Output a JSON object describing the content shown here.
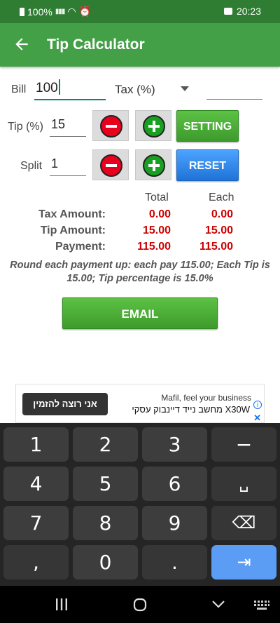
{
  "status": {
    "battery": "100%",
    "time": "20:23"
  },
  "app": {
    "title": "Tip Calculator"
  },
  "bill": {
    "label": "Bill",
    "value": "100"
  },
  "tax": {
    "selected": "Tax (%)",
    "value": ""
  },
  "tip": {
    "label": "Tip (%)",
    "value": "15"
  },
  "split": {
    "label": "Split",
    "value": "1"
  },
  "buttons": {
    "setting": "SETTING",
    "reset": "RESET",
    "email": "EMAIL"
  },
  "results": {
    "headers": {
      "total": "Total",
      "each": "Each"
    },
    "rows": [
      {
        "label": "Tax Amount:",
        "total": "0.00",
        "each": "0.00"
      },
      {
        "label": "Tip Amount:",
        "total": "15.00",
        "each": "15.00"
      },
      {
        "label": "Payment:",
        "total": "115.00",
        "each": "115.00"
      }
    ],
    "summary": "Round each payment up: each pay 115.00; Each Tip is 15.00; Tip percentage is 15.0%"
  },
  "ad": {
    "button": "אני רוצה להזמין",
    "line1": "Mafil, feel your business",
    "line2": "מחשב נייד דיינבוק עסקי X30W"
  },
  "keyboard": {
    "keys": [
      "1",
      "2",
      "3",
      "−",
      "4",
      "5",
      "6",
      "␣",
      "7",
      "8",
      "9",
      "⌫",
      ",",
      "0",
      ".",
      "⇥"
    ]
  },
  "colors": {
    "appbar": "#43a047",
    "statusbar": "#2e7d32",
    "value_red": "#cc0000",
    "green_button": "#4caf50",
    "blue_button": "#2b82e8"
  }
}
